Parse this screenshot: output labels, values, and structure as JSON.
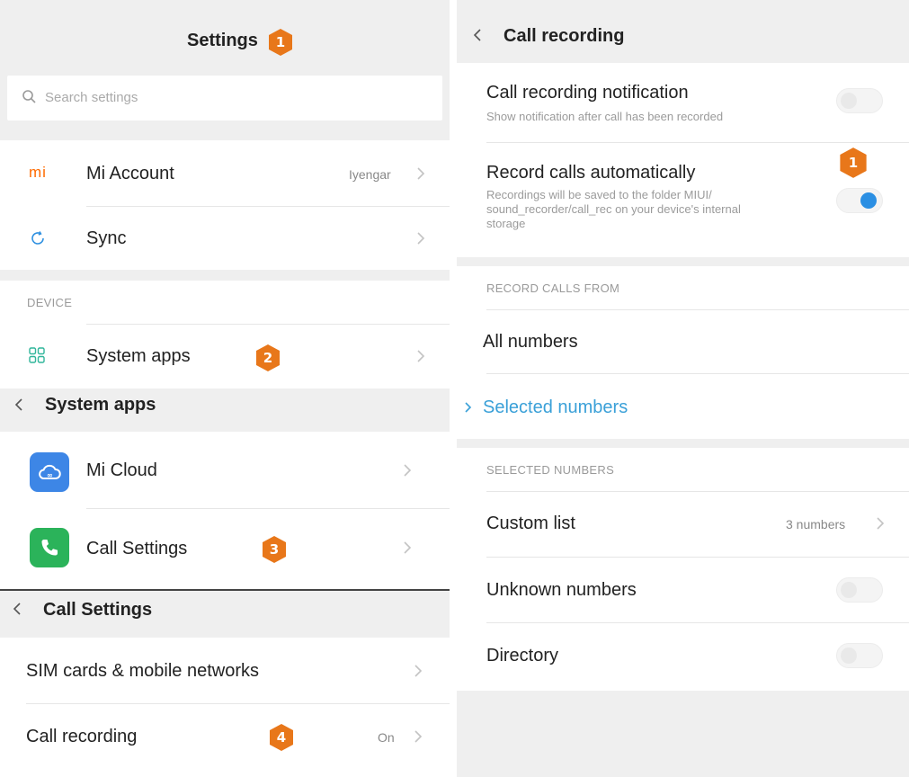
{
  "settings": {
    "title": "Settings",
    "search_placeholder": "Search settings",
    "mi_account": {
      "icon_text": "mi",
      "label": "Mi Account",
      "value": "Iyengar"
    },
    "sync": {
      "label": "Sync"
    },
    "device_section": "DEVICE",
    "system_apps": {
      "label": "System apps"
    }
  },
  "system_apps_screen": {
    "title": "System apps",
    "items": [
      {
        "label": "Mi Cloud"
      },
      {
        "label": "Call Settings"
      }
    ]
  },
  "call_settings_screen": {
    "title": "Call Settings",
    "items": [
      {
        "label": "SIM cards & mobile networks"
      },
      {
        "label": "Call recording",
        "value": "On"
      }
    ]
  },
  "call_recording_screen": {
    "title": "Call recording",
    "notification": {
      "title": "Call recording notification",
      "subtitle": "Show notification after call has been recorded",
      "enabled": false
    },
    "auto_record": {
      "title": "Record calls automatically",
      "subtitle_lines": [
        "Recordings will be saved to the folder MIUI/",
        "sound_recorder/call_rec on your device's internal",
        "storage"
      ],
      "enabled": true
    },
    "record_from_section": "RECORD CALLS FROM",
    "options": [
      {
        "label": "All numbers",
        "selected": false
      },
      {
        "label": "Selected numbers",
        "selected": true
      }
    ],
    "selected_section": "SELECTED NUMBERS",
    "custom_list": {
      "label": "Custom list",
      "value": "3 numbers"
    },
    "unknown_numbers": {
      "label": "Unknown numbers",
      "enabled": false
    },
    "directory": {
      "label": "Directory",
      "enabled": false
    }
  },
  "badges": {
    "settings": "1",
    "system_apps": "2",
    "call_settings": "3",
    "call_recording": "4",
    "auto_record": "1"
  },
  "colors": {
    "badge_orange": "#e8771a",
    "accent_blue": "#2b8fe3",
    "selected_text": "#3aa0d8",
    "mi_orange": "#ff6a00",
    "cloud_blue": "#3d86e6",
    "phone_green": "#2bb35a",
    "apps_teal": "#2fb59a",
    "sync_blue": "#2e90e0"
  },
  "icons": {
    "mi_account": "mi-logo-icon",
    "sync": "sync-icon",
    "system_apps": "grid-icon",
    "mi_cloud": "cloud-icon",
    "call_settings": "phone-icon",
    "search": "search-icon",
    "back": "back-chevron-icon",
    "forward": "chevron-right-icon"
  }
}
